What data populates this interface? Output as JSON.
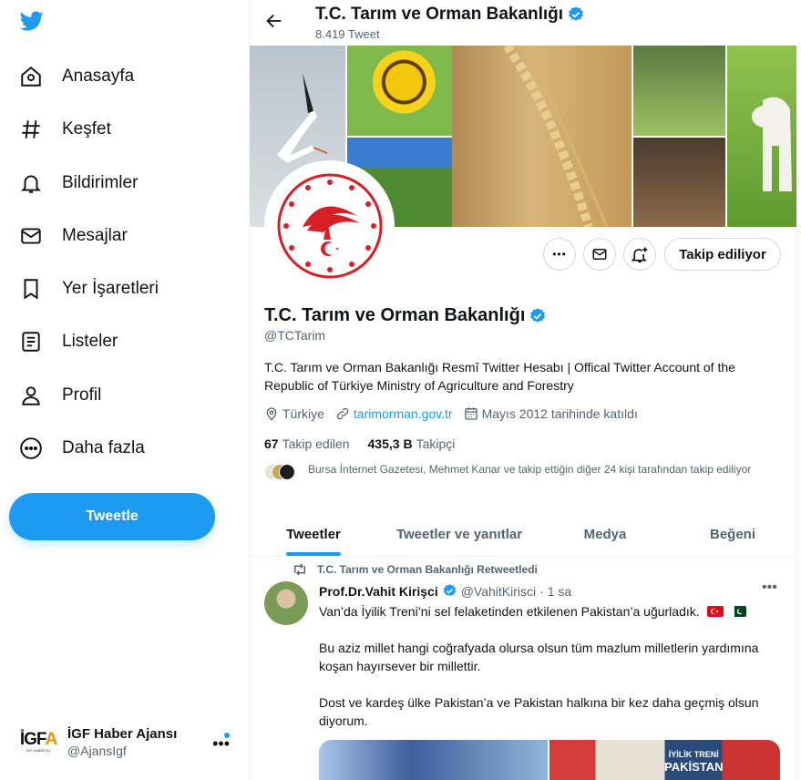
{
  "sidebar": {
    "logo_icon": "twitter-bird-icon",
    "items": [
      {
        "label": "Anasayfa",
        "icon": "home-icon"
      },
      {
        "label": "Keşfet",
        "icon": "hashtag-icon"
      },
      {
        "label": "Bildirimler",
        "icon": "bell-icon"
      },
      {
        "label": "Mesajlar",
        "icon": "mail-icon"
      },
      {
        "label": "Yer İşaretleri",
        "icon": "bookmark-icon"
      },
      {
        "label": "Listeler",
        "icon": "list-icon"
      },
      {
        "label": "Profil",
        "icon": "user-icon"
      },
      {
        "label": "Daha fazla",
        "icon": "more-circle-icon"
      }
    ],
    "tweet_button": "Tweetle",
    "account": {
      "name": "İGF Haber Ajansı",
      "handle": "@AjansIgf",
      "avatar_text_main": "İGF",
      "avatar_text_accent": "A",
      "avatar_subtext": "İGF HABER AJ"
    }
  },
  "header": {
    "title": "T.C. Tarım ve Orman Bakanlığı",
    "tweet_count": "8.419 Tweet"
  },
  "profile": {
    "name": "T.C. Tarım ve Orman Bakanlığı",
    "handle": "@TCTarim",
    "bio": "T.C. Tarım ve Orman Bakanlığı Resmî Twitter Hesabı | Offical Twitter Account of the Republic of Türkiye Ministry of Agriculture and Forestry",
    "location": "Türkiye",
    "website": "tarimorman.gov.tr",
    "joined": "Mayıs 2012 tarihinde katıldı",
    "following_count": "67",
    "following_label": "Takip edilen",
    "followers_count": "435,3 B",
    "followers_label": "Takipçi",
    "mutual_text": "Bursa İnternet Gazetesi, Mehmet Kanar ve takip ettiğin diğer 24 kişi tarafından takip ediliyor",
    "follow_button": "Takip ediliyor"
  },
  "tabs": [
    {
      "label": "Tweetler",
      "active": true
    },
    {
      "label": "Tweetler ve yanıtlar",
      "active": false
    },
    {
      "label": "Medya",
      "active": false
    },
    {
      "label": "Beğeni",
      "active": false
    }
  ],
  "tweet": {
    "retweet_label": "T.C. Tarım ve Orman Bakanlığı Retweetledi",
    "author_name": "Prof.Dr.Vahit Kirişci",
    "author_handle": "@VahitKirisci",
    "time": "· 1 sa",
    "paragraph1": "Van’da İyilik Treni’ni sel felaketinden etkilenen Pakistan’a uğurladık.",
    "paragraph2": "Bu aziz millet hangi coğrafyada olursa olsun tüm mazlum milletlerin yardımına koşan hayırsever bir millettir.",
    "paragraph3": "Dost ve kardeş ülke Pakistan’a ve Pakistan halkına bir kez daha geçmiş olsun diyorum.",
    "media_caption_line1": "İYİLİK TRENİ",
    "media_caption_line2": "PAKİSTAN"
  },
  "colors": {
    "accent": "#1d9bf0",
    "text": "#0f1419",
    "secondary": "#536471",
    "logo_red": "#d71f26"
  }
}
